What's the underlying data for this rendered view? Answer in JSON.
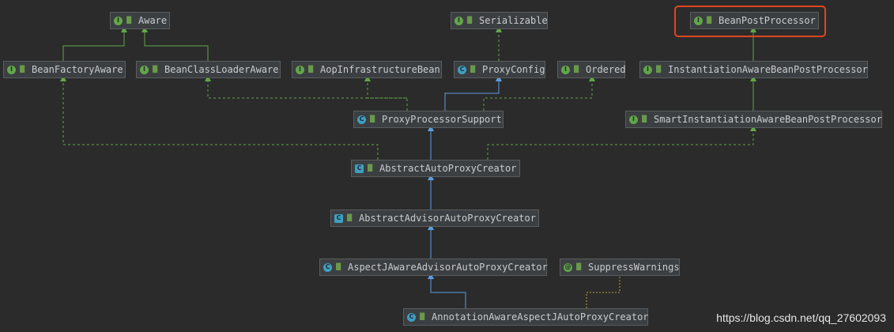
{
  "nodes": [
    {
      "id": "aware",
      "label": "Aware",
      "kind": "interface"
    },
    {
      "id": "serializable",
      "label": "Serializable",
      "kind": "interface"
    },
    {
      "id": "beanpostprocessor",
      "label": "BeanPostProcessor",
      "kind": "interface",
      "highlighted": true
    },
    {
      "id": "beanfactoryaware",
      "label": "BeanFactoryAware",
      "kind": "interface"
    },
    {
      "id": "beanclassloaderaware",
      "label": "BeanClassLoaderAware",
      "kind": "interface"
    },
    {
      "id": "aopinfrastructurebean",
      "label": "AopInfrastructureBean",
      "kind": "interface"
    },
    {
      "id": "proxyconfig",
      "label": "ProxyConfig",
      "kind": "class"
    },
    {
      "id": "ordered",
      "label": "Ordered",
      "kind": "interface"
    },
    {
      "id": "instantiationaware",
      "label": "InstantiationAwareBeanPostProcessor",
      "kind": "interface"
    },
    {
      "id": "proxyprocessorsupport",
      "label": "ProxyProcessorSupport",
      "kind": "class"
    },
    {
      "id": "smartinstantiationaware",
      "label": "SmartInstantiationAwareBeanPostProcessor",
      "kind": "interface"
    },
    {
      "id": "abstractautoproxycreator",
      "label": "AbstractAutoProxyCreator",
      "kind": "abstract"
    },
    {
      "id": "abstractadvisorautoproxycreator",
      "label": "AbstractAdvisorAutoProxyCreator",
      "kind": "abstract"
    },
    {
      "id": "aspectjawareadvisorautoproxycreator",
      "label": "AspectJAwareAdvisorAutoProxyCreator",
      "kind": "class"
    },
    {
      "id": "suppresswarnings",
      "label": "SuppressWarnings",
      "kind": "annotation"
    },
    {
      "id": "annotationawareaspectjautoproxycreator",
      "label": "AnnotationAwareAspectJAutoProxyCreator",
      "kind": "class"
    }
  ],
  "edges": [
    {
      "from": "beanfactoryaware",
      "to": "aware",
      "type": "extends"
    },
    {
      "from": "beanclassloaderaware",
      "to": "aware",
      "type": "extends"
    },
    {
      "from": "proxyconfig",
      "to": "serializable",
      "type": "implements"
    },
    {
      "from": "instantiationaware",
      "to": "beanpostprocessor",
      "type": "extends"
    },
    {
      "from": "smartinstantiationaware",
      "to": "instantiationaware",
      "type": "extends"
    },
    {
      "from": "proxyprocessorsupport",
      "to": "beanclassloaderaware",
      "type": "implements"
    },
    {
      "from": "proxyprocessorsupport",
      "to": "aopinfrastructurebean",
      "type": "implements"
    },
    {
      "from": "proxyprocessorsupport",
      "to": "proxyconfig",
      "type": "extends-class"
    },
    {
      "from": "proxyprocessorsupport",
      "to": "ordered",
      "type": "implements"
    },
    {
      "from": "abstractautoproxycreator",
      "to": "beanfactoryaware",
      "type": "implements"
    },
    {
      "from": "abstractautoproxycreator",
      "to": "proxyprocessorsupport",
      "type": "extends-class"
    },
    {
      "from": "abstractautoproxycreator",
      "to": "smartinstantiationaware",
      "type": "implements"
    },
    {
      "from": "abstractadvisorautoproxycreator",
      "to": "abstractautoproxycreator",
      "type": "extends-class"
    },
    {
      "from": "aspectjawareadvisorautoproxycreator",
      "to": "abstractadvisorautoproxycreator",
      "type": "extends-class"
    },
    {
      "from": "annotationawareaspectjautoproxycreator",
      "to": "aspectjawareadvisorautoproxycreator",
      "type": "extends-class"
    },
    {
      "from": "annotationawareaspectjautoproxycreator",
      "to": "suppresswarnings",
      "type": "annotated"
    }
  ],
  "colors": {
    "background": "#2b2b2b",
    "node_fill": "#3c3f41",
    "node_text": "#c9ccce",
    "interface_icon": "#62a64a",
    "class_icon": "#3d9fc4",
    "extends_line": "#62a64a",
    "implements_line": "#62a64a",
    "class_line": "#5e9de0",
    "highlight": "#e0451f",
    "annotation_line": "#b8a03a"
  },
  "icons": {
    "interface": "I",
    "class": "C",
    "abstract": "C",
    "annotation": "@"
  },
  "watermark": "https://blog.csdn.net/qq_27602093"
}
